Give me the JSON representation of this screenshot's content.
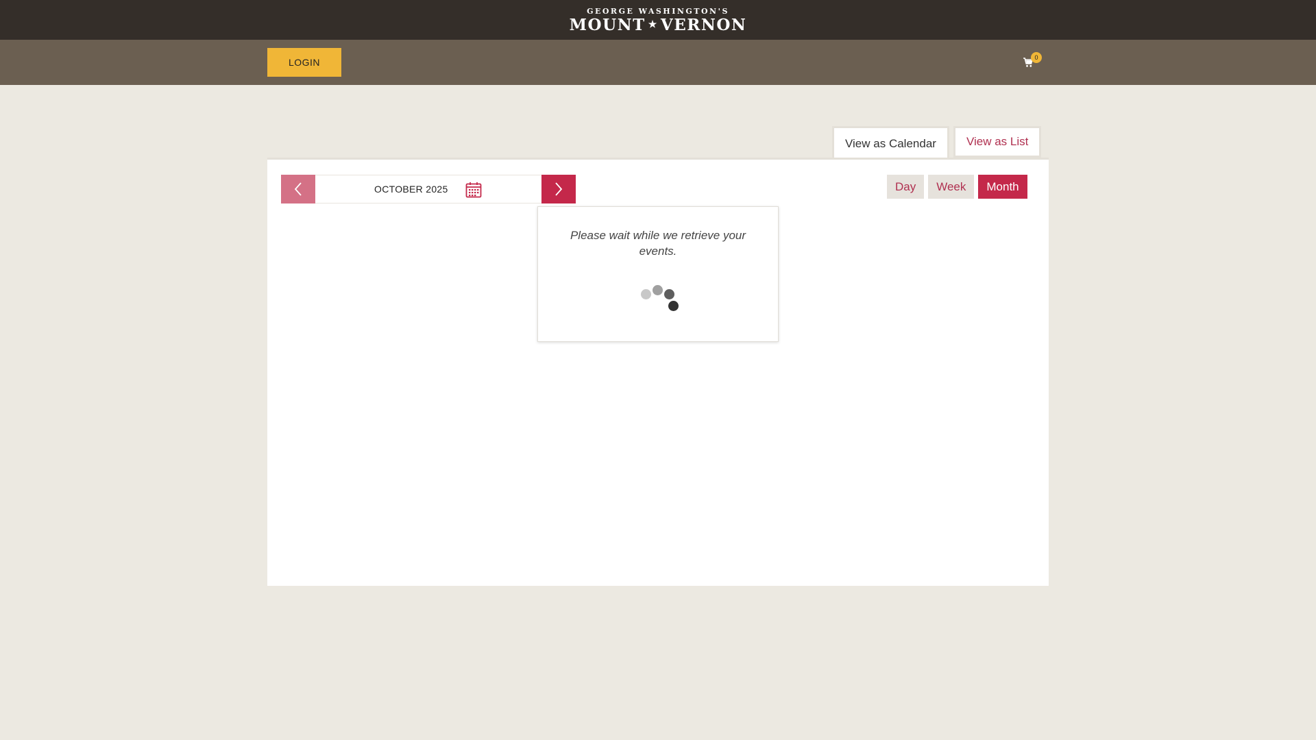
{
  "header": {
    "logo_top": "GEORGE WASHINGTON'S",
    "logo_left": "MOUNT",
    "logo_star": "★",
    "logo_right": "VERNON"
  },
  "subbar": {
    "login_label": "LOGIN",
    "cart_count": "0"
  },
  "view_tabs": {
    "calendar_label": "View as Calendar",
    "list_label": "View as List"
  },
  "calendar": {
    "month_label": "OCTOBER 2025",
    "range_buttons": [
      {
        "label": "Day"
      },
      {
        "label": "Week"
      },
      {
        "label": "Month"
      }
    ],
    "active_range": "Month"
  },
  "loading": {
    "message": "Please wait while we retrieve your events."
  },
  "colors": {
    "topbar": "#342e29",
    "subbar": "#6b5f51",
    "login_button": "#f0b637",
    "accent": "#c4284a",
    "accent_light": "#d47186",
    "background": "#ece9e1"
  }
}
